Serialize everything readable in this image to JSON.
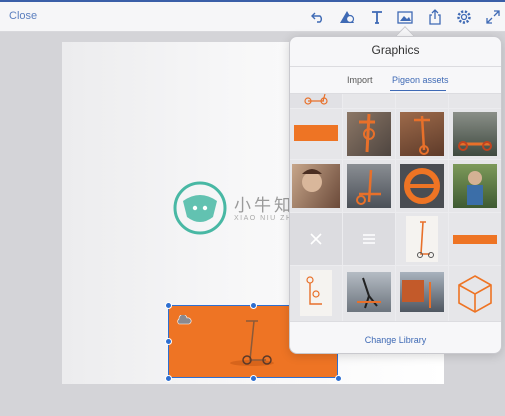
{
  "toolbar": {
    "close_label": "Close",
    "icons": [
      "undo-icon",
      "shape-icon",
      "text-icon",
      "image-icon",
      "share-icon",
      "settings-icon",
      "fullscreen-icon"
    ]
  },
  "popover": {
    "title": "Graphics",
    "tabs": [
      {
        "label": "Import",
        "selected": false
      },
      {
        "label": "Pigeon assets",
        "selected": true
      }
    ],
    "footer_link": "Change Library"
  },
  "watermark": {
    "title": "小牛知识",
    "subtitle": "XIAO NIU ZHI SHI KU"
  },
  "colors": {
    "accent": "#3f6ab5",
    "orange": "#ee7424",
    "selection": "#2e6fd1"
  }
}
